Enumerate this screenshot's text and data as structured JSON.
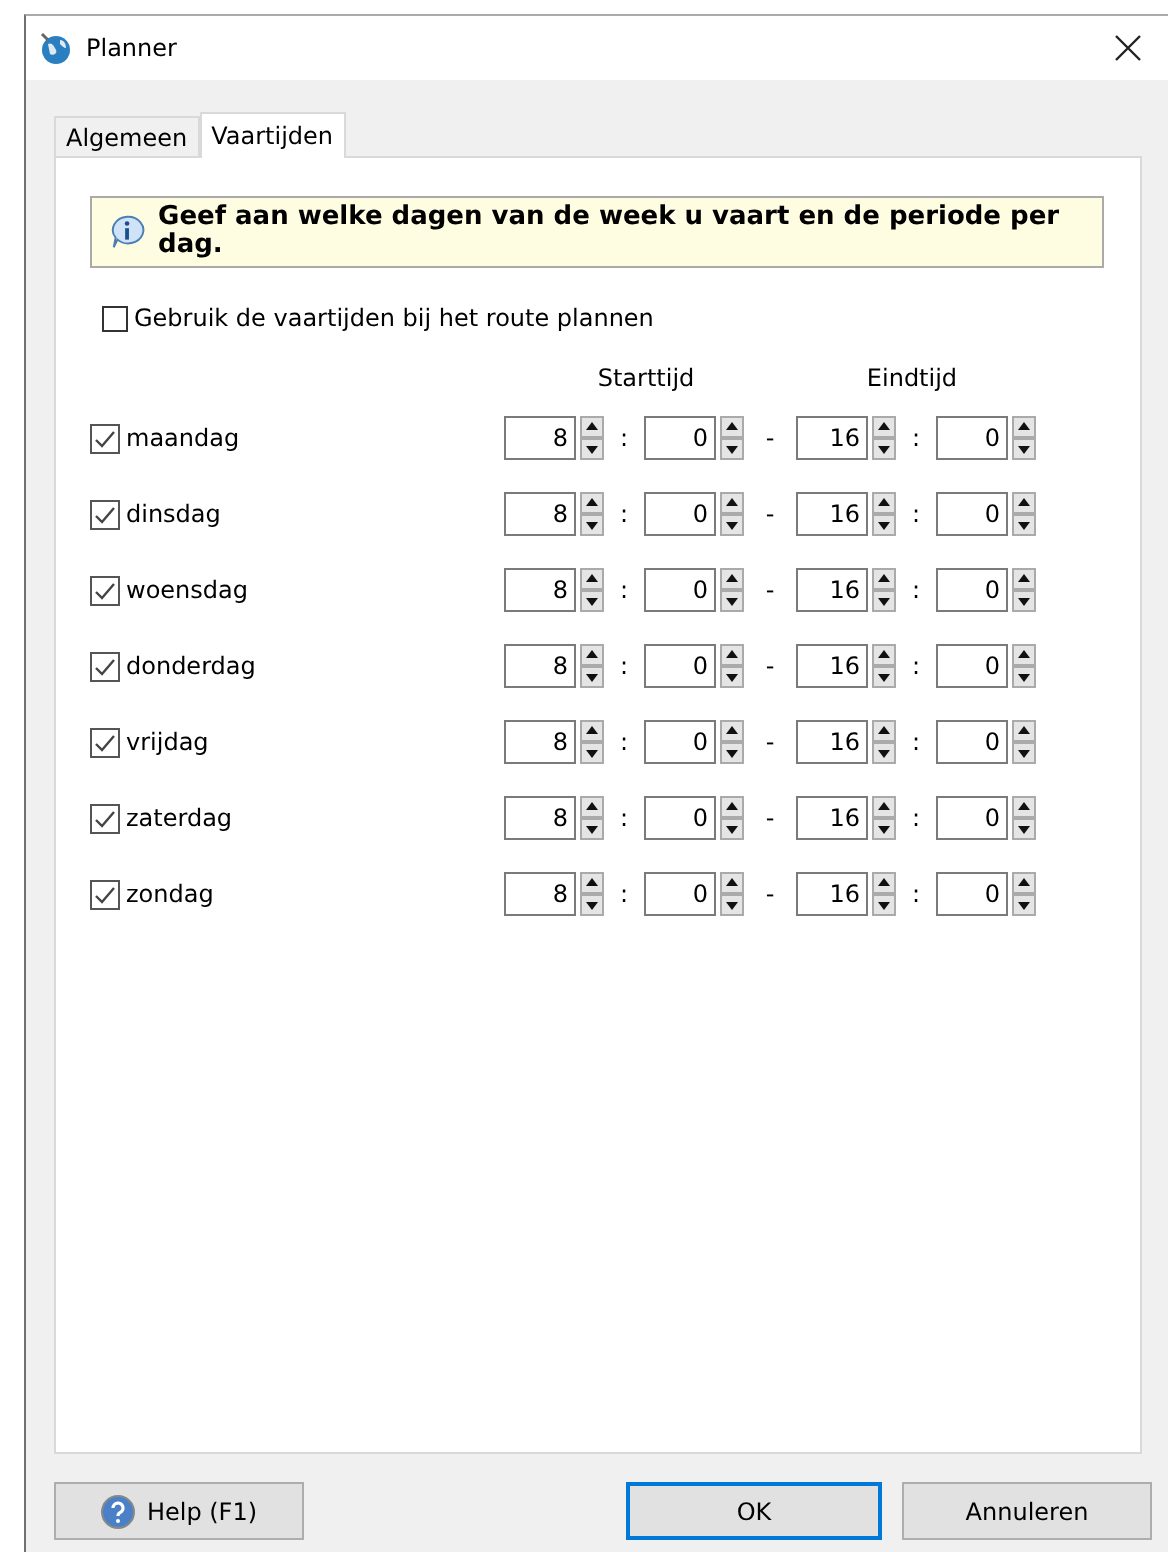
{
  "window": {
    "title": "Planner"
  },
  "tabs": [
    {
      "label": "Algemeen",
      "selected": false
    },
    {
      "label": "Vaartijden",
      "selected": true
    }
  ],
  "info": "Geef aan welke dagen van de week u vaart en de periode per dag.",
  "use_times": {
    "label": "Gebruik de vaartijden bij het route plannen",
    "checked": false
  },
  "columns": {
    "start": "Starttijd",
    "end": "Eindtijd"
  },
  "separators": {
    "colon": ":",
    "dash": "-"
  },
  "days": [
    {
      "label": "maandag",
      "checked": true,
      "start_hour": "8",
      "start_minute": "0",
      "end_hour": "16",
      "end_minute": "0"
    },
    {
      "label": "dinsdag",
      "checked": true,
      "start_hour": "8",
      "start_minute": "0",
      "end_hour": "16",
      "end_minute": "0"
    },
    {
      "label": "woensdag",
      "checked": true,
      "start_hour": "8",
      "start_minute": "0",
      "end_hour": "16",
      "end_minute": "0"
    },
    {
      "label": "donderdag",
      "checked": true,
      "start_hour": "8",
      "start_minute": "0",
      "end_hour": "16",
      "end_minute": "0"
    },
    {
      "label": "vrijdag",
      "checked": true,
      "start_hour": "8",
      "start_minute": "0",
      "end_hour": "16",
      "end_minute": "0"
    },
    {
      "label": "zaterdag",
      "checked": true,
      "start_hour": "8",
      "start_minute": "0",
      "end_hour": "16",
      "end_minute": "0"
    },
    {
      "label": "zondag",
      "checked": true,
      "start_hour": "8",
      "start_minute": "0",
      "end_hour": "16",
      "end_minute": "0"
    }
  ],
  "buttons": [
    {
      "kind": "help",
      "label": "Help (F1)"
    },
    {
      "kind": "default",
      "label": "OK"
    },
    {
      "kind": "normal",
      "label": "Annuleren"
    }
  ]
}
